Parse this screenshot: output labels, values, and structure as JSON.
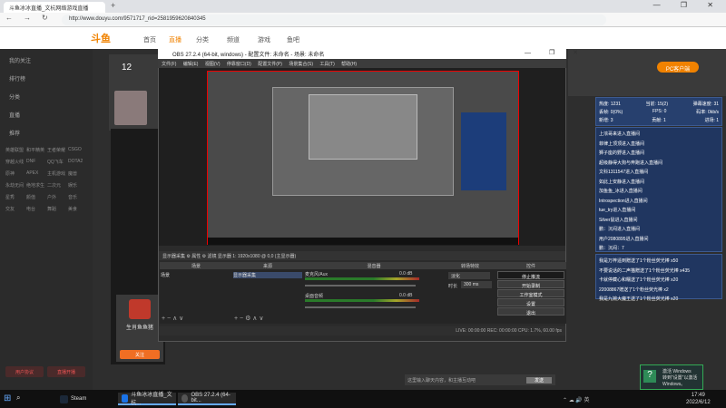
{
  "browser": {
    "tab_title": "斗鱼冰冰直播_文杭网络游戏直播",
    "new_tab": "+",
    "window_controls": "— ❐ ✕",
    "url": "http://www.douyu.com/9571717_rid=2581959620840345"
  },
  "site": {
    "logo": "斗鱼",
    "nav": [
      "首页",
      "直播",
      "分类",
      "频道",
      "游戏",
      "鱼吧"
    ],
    "follow_count": "12",
    "pc_button": "PC客户端"
  },
  "sidebar": {
    "items": [
      "我的关注",
      "排行榜",
      "分类",
      "直播",
      "推荐"
    ],
    "grid": [
      "英雄联盟",
      "和平精英",
      "王者荣耀",
      "CSGO",
      "穿越火线",
      "DNF",
      "QQ飞车",
      "DOTA2",
      "原神",
      "APEX",
      "主机游戏",
      "魔兽",
      "永劫无间",
      "绝地求生",
      "二次元",
      "娱乐",
      "星秀",
      "颜值",
      "户外",
      "音乐",
      "交友",
      "电台",
      "舞蹈",
      "美食"
    ],
    "btn1": "用户协议",
    "btn2": "直播开播"
  },
  "room": {
    "name": "生肖鱼鱼猪",
    "follow_label": "关注"
  },
  "obs": {
    "title": "OBS 27.2.4 (64-bit, windows) - 配置文件: 未命名 - 场景: 未命名",
    "window_controls": "— ❐ ✕",
    "menu": [
      "文件(F)",
      "编辑(E)",
      "视图(V)",
      "停靠窗口(D)",
      "配置文件(P)",
      "场景集合(S)",
      "工具(T)",
      "帮助(H)"
    ],
    "status_line": "显示器采集    ⚙ 属性    ⚙ 滤镜    显示器 1: 1920x1080 @ 0,0 (主显示器)",
    "dock_headers": [
      "场景",
      "来源",
      "混音器",
      "转场特效",
      "控件"
    ],
    "scene": "场景",
    "source": "显示器采集",
    "mixer": [
      {
        "name": "麦克风/Aux",
        "db": "0.0 dB"
      },
      {
        "name": "桌面音频",
        "db": "0.0 dB"
      }
    ],
    "transition": {
      "type": "淡化",
      "duration_label": "时长",
      "duration": "300 ms"
    },
    "controls": [
      "停止推流",
      "开始录制",
      "工作室模式",
      "设置",
      "退出"
    ],
    "status_bar": "LIVE: 00:00:00   REC: 00:00:00   CPU: 1.7%, 60.00 fps"
  },
  "chat": {
    "stats": [
      {
        "label": "热度:",
        "value": "1231",
        "label2": "当前:",
        "value2": "15(2)",
        "label3": "弹幕速度:",
        "value3": "31"
      },
      {
        "label": "丢帧:",
        "value": "0(0%)",
        "label2": "FPS:",
        "value2": "0",
        "label3": "码率:",
        "value3": "0kb/s"
      },
      {
        "label": "新增:",
        "value": "3",
        "label2": "贡献:",
        "value2": "1",
        "label3": "进场:",
        "value3": "1"
      }
    ],
    "messages": [
      "上浓哥来进入直播间",
      "菲律上顶顶进入直播间",
      "狮子座的野进入直播间",
      "超级静得大狗与奔跑进入直播间",
      "文科1311547进入直播间",
      "如此上安静进入直播间",
      "加鱼鱼_冰进入直播间",
      "Introspection进入直播间",
      "tue_try进入直播间",
      "Silver鼠进入直播间",
      "鹏：沉闷进入直播间",
      "用户2080895进入直播间",
      "鹏：沉闷：7",
      "白鹿狮157进入直播间"
    ],
    "gifts": [
      "我是万梓遥到赠送了1个粉丝荧光棒 x50",
      "不要说话的二声猫赠送了1个粉丝荧光棒 x435",
      "卡就停藏心和糯送了1个粉丝荧光棒 x20",
      "22008867赠送了1个粉丝荧光棒 x2",
      "我是九婉大魔王送了1个粉丝荧光棒 x20"
    ],
    "input_placeholder": "这里输入聊天内容，和主播互动吧",
    "send": "发送"
  },
  "activate": {
    "line1": "激活 Windows",
    "line2": "转到“设置”以激活",
    "line3": "Windows。"
  },
  "taskbar": {
    "apps": [
      "Steam",
      "斗鱼冰冰直播_文杭...",
      "OBS 27.2.4 (64-bit..."
    ],
    "tray": "⌃  ☁  🔊  英",
    "time": "17:49",
    "date": "2022/6/12"
  },
  "colors": {
    "accent": "#f08200",
    "chat_bg": "#203660",
    "obs_bg": "#2b2b2b"
  }
}
